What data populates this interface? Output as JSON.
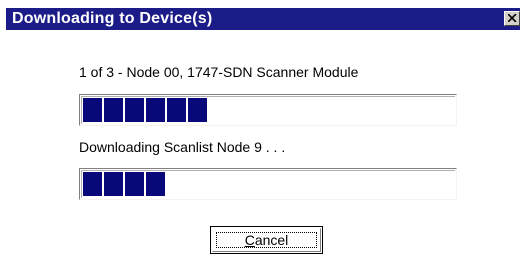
{
  "window": {
    "title": "Downloading to Device(s)",
    "close_icon": "close-icon"
  },
  "step1": {
    "label": "1 of 3 - Node 00, 1747-SDN Scanner Module",
    "progress_fraction": 0.33
  },
  "step2": {
    "label": "Downloading Scanlist Node 9 . . .",
    "progress_fraction": 0.22
  },
  "buttons": {
    "cancel_mnemonic": "C",
    "cancel_rest": "ancel"
  },
  "colors": {
    "titlebar": "#1c1c88",
    "progress_block": "#08087a"
  }
}
